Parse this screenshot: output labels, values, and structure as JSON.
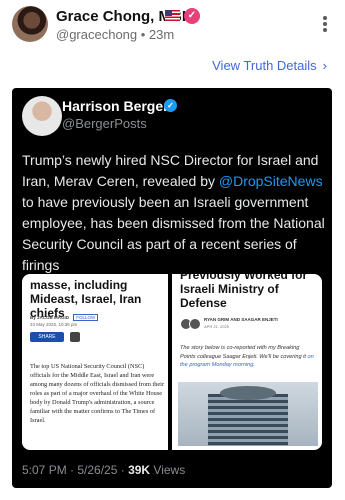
{
  "post": {
    "author_name": "Grace Chong, MBI",
    "handle": "@gracechong",
    "separator": "•",
    "time": "23m",
    "view_link": "View Truth Details",
    "view_link_chevron": "›"
  },
  "embed": {
    "name": "Harrison Berger",
    "handle": "@BergerPosts",
    "text_before": "Trump’s newly hired NSC Director for Israel and Iran, Merav Ceren, revealed by ",
    "mention": "@DropSiteNews",
    "text_after": " to have previously been an Israeli government employee, has been dismissed from the National Security Council as part of a recent series of firings",
    "timestamp": "5:07 PM · 5/26/25 · ",
    "views_count": "39K",
    "views_label": " Views"
  },
  "article_left": {
    "headline": "masse, including Mideast, Israel, Iran chiefs",
    "byline": "By JACOB MAGID",
    "follow": "FOLLOW",
    "date": "23 May 2025, 10:36 pm",
    "share": "SHARE",
    "body": "The top US National Security Council (NSC) officials for the Middle East, Israel and Iran were among many dozens of officials dismissed from their roles as part of a major overhaul of the White House body by Donald Trump's administration, a source familiar with the matter confirms to The Times of Israel."
  },
  "article_right": {
    "topline": "Previously Worked for",
    "headline": "Israeli Ministry of Defense",
    "authors": "RYAN GRIM AND SAAGAR ENJETI",
    "date": "APR 21, 2025",
    "italic_text": "The story below is co-reported with my Breaking Points colleague Saagar Enjeti. We'll be covering it ",
    "italic_link": "on the program Monday morning",
    "italic_end": "."
  },
  "icons": {
    "more": "more-vertical-icon",
    "verified": "verified-badge-icon",
    "flag": "us-flag-icon"
  },
  "colors": {
    "link_blue": "#3d6bd6",
    "mention_blue": "#1d9bf0",
    "badge_pink": "#e8407a",
    "embed_bg": "#000000"
  }
}
